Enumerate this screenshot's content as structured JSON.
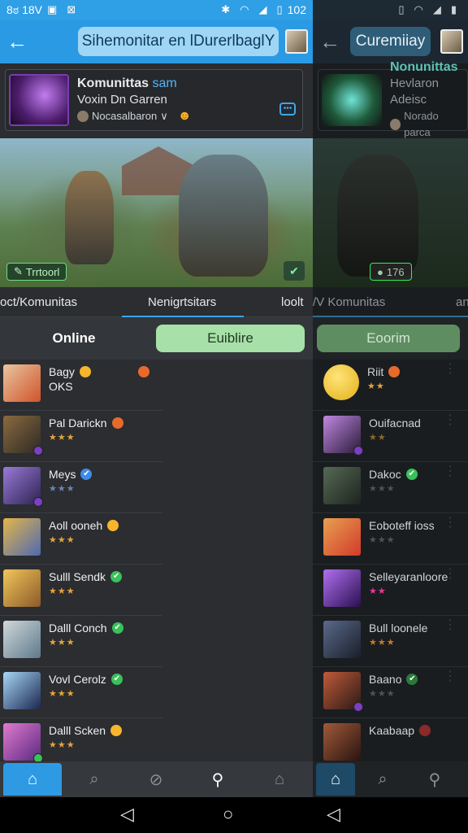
{
  "left": {
    "status": {
      "left_text": "8ಠ 18V",
      "time": "102"
    },
    "header": {
      "title": "Sihemonitar en lDurerlbaglY"
    },
    "card": {
      "title": "Komunittas",
      "title_accent": "sam",
      "subtitle": "Voxin Dn Garren",
      "user": "Nocasalbaron"
    },
    "hero_badge": "Trrtoorl",
    "tabs": [
      "oct/Komunitas",
      "Nenigrtsitars",
      "loolt"
    ],
    "segment": {
      "online": "Online",
      "active": "Euiblire"
    },
    "list": [
      {
        "name": "Bagy",
        "sub": "OKS",
        "stars": "",
        "icon": "emoji"
      },
      {
        "name": "Pal Darickn",
        "sub": "",
        "stars": "★★★",
        "icon": "emoji"
      },
      {
        "name": "Meys",
        "sub": "",
        "stars": "★★★",
        "icon": "check-blue"
      },
      {
        "name": "Aoll ooneh",
        "sub": "",
        "stars": "★★★",
        "icon": "emoji"
      },
      {
        "name": "Sulll Sendk",
        "sub": "",
        "stars": "★★★",
        "icon": "check"
      },
      {
        "name": "Dalll Conch",
        "sub": "",
        "stars": "★★★",
        "icon": "check"
      },
      {
        "name": "Vovl Cerolz",
        "sub": "",
        "stars": "★★★",
        "icon": "check"
      },
      {
        "name": "Dalll Scken",
        "sub": "",
        "stars": "★★★",
        "icon": "emoji"
      }
    ]
  },
  "right": {
    "header": {
      "title": "Curemiiay"
    },
    "card": {
      "title": "Nonunittas",
      "subtitle": "Hevlaron Adeisc",
      "user": "Norado parca"
    },
    "hero_badge": "176",
    "tabs": [
      "/V Komunitas",
      "an"
    ],
    "segment": {
      "active": "Eoorim"
    },
    "list": [
      {
        "name": "Riit",
        "stars": "★★",
        "icon": "emoji-red"
      },
      {
        "name": "Ouifacnad",
        "stars": "★★",
        "icon": ""
      },
      {
        "name": "Dakoc",
        "stars": "★★★",
        "icon": "check"
      },
      {
        "name": "Eoboteff ioss",
        "stars": "★★★",
        "icon": ""
      },
      {
        "name": "Selleyaranloore",
        "stars": "★★",
        "icon": ""
      },
      {
        "name": "Bull loonele",
        "stars": "★★★",
        "icon": ""
      },
      {
        "name": "Baano",
        "stars": "★★★",
        "icon": "check"
      },
      {
        "name": "Kaabaap",
        "stars": "",
        "icon": "emoji-red"
      }
    ]
  }
}
